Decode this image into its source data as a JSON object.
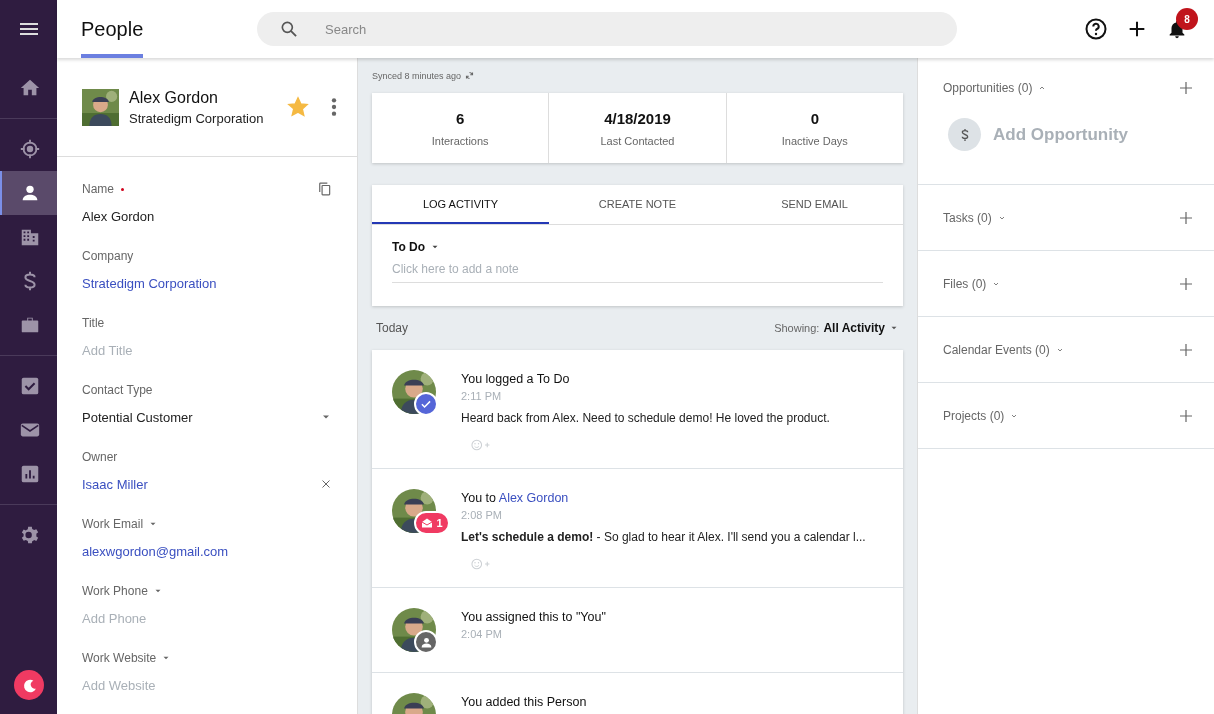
{
  "header": {
    "title": "People",
    "title_selected": true,
    "search": {
      "placeholder": "Search"
    },
    "notifications": {
      "count": "8"
    }
  },
  "nav_groups": [
    [
      {
        "selected": false
      }
    ],
    [
      {
        "selected": false
      },
      {
        "selected": true
      },
      {
        "selected": false
      },
      {
        "selected": false
      },
      {
        "selected": false
      }
    ],
    [
      {
        "selected": false
      },
      {
        "selected": false
      },
      {
        "selected": false
      }
    ],
    [
      {
        "selected": false
      }
    ]
  ],
  "profile": {
    "name": "Alex Gordon",
    "company": "Stratedigm Corporation",
    "starred": true
  },
  "fields": [
    {
      "label": "Name",
      "required": true,
      "label_menu": false,
      "kind": "copyable",
      "value": "Alex Gordon"
    },
    {
      "label": "Company",
      "required": false,
      "label_menu": false,
      "kind": "link",
      "value": "Stratedigm Corporation"
    },
    {
      "label": "Title",
      "required": false,
      "label_menu": false,
      "kind": "text",
      "placeholder": "Add Title"
    },
    {
      "label": "Contact Type",
      "required": false,
      "label_menu": false,
      "kind": "select",
      "value": "Potential Customer"
    },
    {
      "label": "Owner",
      "required": false,
      "label_menu": false,
      "kind": "removable",
      "value": "Isaac Miller"
    },
    {
      "label": "Work Email",
      "required": false,
      "label_menu": true,
      "kind": "link",
      "value": "alexwgordon@gmail.com"
    },
    {
      "label": "Work Phone",
      "required": false,
      "label_menu": true,
      "kind": "text",
      "placeholder": "Add Phone"
    },
    {
      "label": "Work Website",
      "required": false,
      "label_menu": true,
      "kind": "text",
      "placeholder": "Add Website"
    }
  ],
  "sync_status": "Synced 8 minutes ago",
  "stats": [
    {
      "value": "6",
      "label": "Interactions"
    },
    {
      "value": "4/18/2019",
      "label": "Last Contacted"
    },
    {
      "value": "0",
      "label": "Inactive Days"
    }
  ],
  "composer": {
    "tabs": [
      {
        "label": "LOG ACTIVITY",
        "selected": true
      },
      {
        "label": "CREATE NOTE",
        "selected": false
      },
      {
        "label": "SEND EMAIL",
        "selected": false
      }
    ],
    "activity_type": "To Do",
    "placeholder": "Click here to add a note"
  },
  "feed": {
    "day": "Today",
    "filter_label": "Showing:",
    "filter_value": "All Activity",
    "items": [
      {
        "kind": "done",
        "title": "You logged a To Do",
        "time": "2:11 PM",
        "body": "Heard back from Alex. Need to schedule demo! He loved the product.",
        "reactions": true
      },
      {
        "kind": "email",
        "badge_count": "1",
        "title": "You to",
        "title_link": "Alex Gordon",
        "time": "2:08 PM",
        "body": "**Let's schedule a demo!** - So glad to hear it Alex. I'll send you a calendar l...",
        "reactions": true
      },
      {
        "kind": "assigned",
        "title": "You assigned this to \"You\"",
        "time": "2:04 PM",
        "reactions": false
      },
      {
        "title": "You added this Person",
        "reactions": false
      }
    ]
  },
  "related": [
    {
      "title": "Opportunities (0)",
      "expanded": true,
      "add_label": "Add Opportunity"
    },
    {
      "title": "Tasks (0)",
      "expanded": false
    },
    {
      "title": "Files (0)",
      "expanded": false
    },
    {
      "title": "Calendar Events (0)",
      "expanded": false
    },
    {
      "title": "Projects (0)",
      "expanded": false
    }
  ]
}
